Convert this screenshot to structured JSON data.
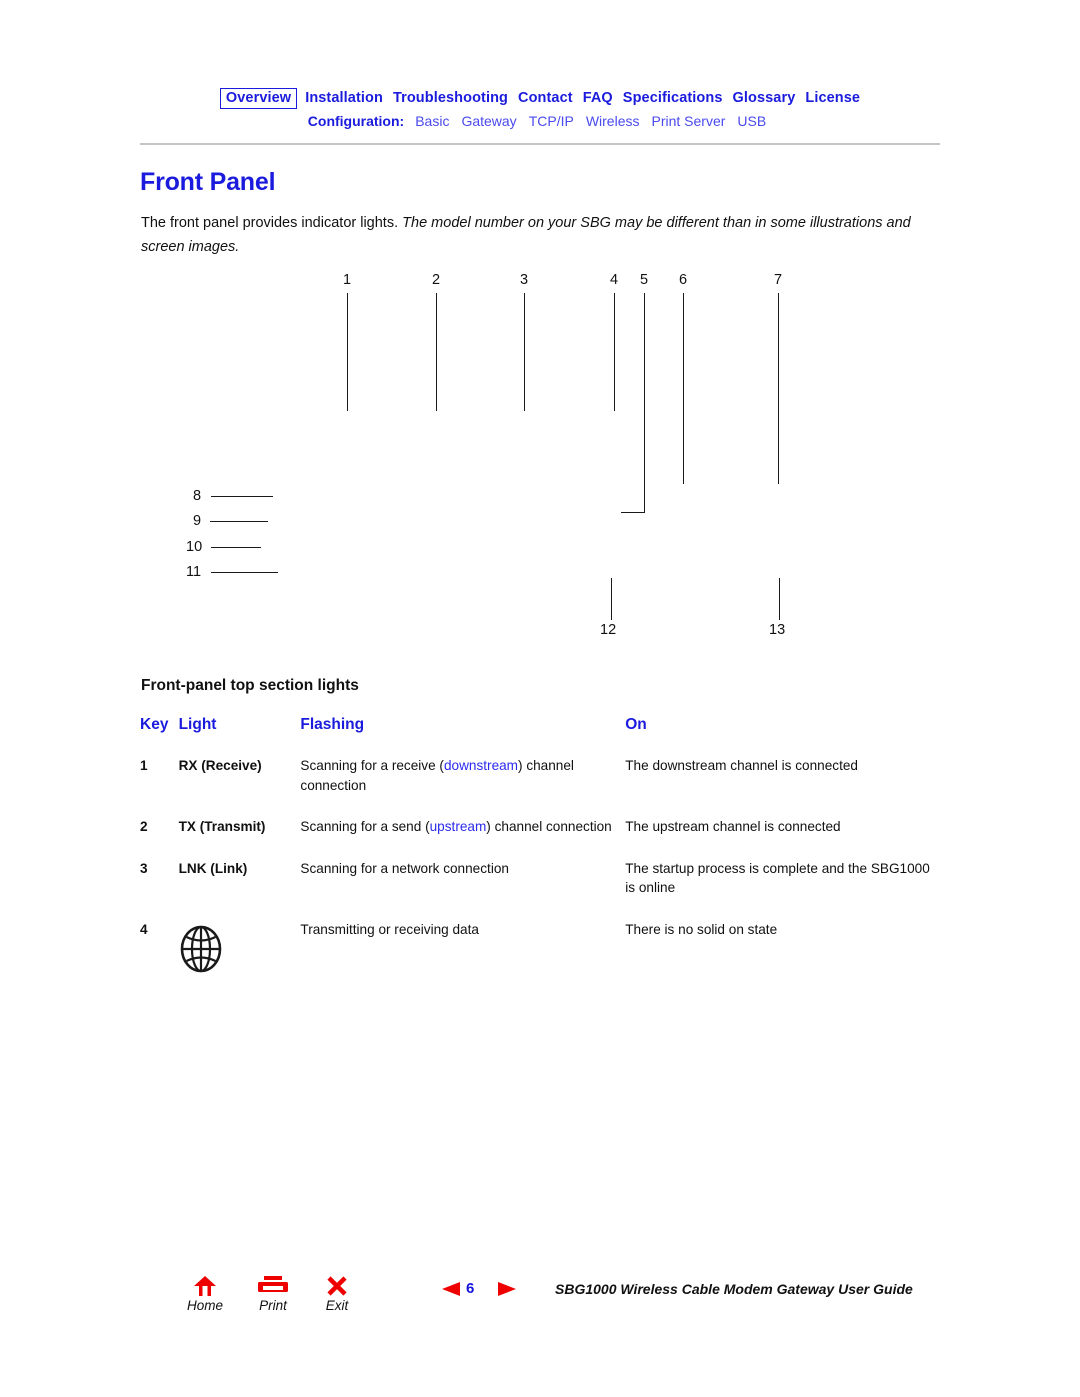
{
  "nav": {
    "primary": [
      {
        "label": "Overview",
        "boxed": true
      },
      {
        "label": "Installation",
        "boxed": false
      },
      {
        "label": "Troubleshooting",
        "boxed": false
      },
      {
        "label": "Contact",
        "boxed": false
      },
      {
        "label": "FAQ",
        "boxed": false
      },
      {
        "label": "Specifications",
        "boxed": false
      },
      {
        "label": "Glossary",
        "boxed": false
      },
      {
        "label": "License",
        "boxed": false
      }
    ],
    "config_label": "Configuration:",
    "config_items": [
      "Basic",
      "Gateway",
      "TCP/IP",
      "Wireless",
      "Print Server",
      "USB"
    ],
    "colors": {
      "primary": "#1b1bdd",
      "secondary": "#4a4aee"
    }
  },
  "page": {
    "title": "Front Panel",
    "intro_plain": "The front panel provides indicator lights. ",
    "intro_italic": "The model number on your SBG may be different than in some illustrations and screen images."
  },
  "diagram": {
    "callouts": [
      "1",
      "2",
      "3",
      "4",
      "5",
      "6",
      "7",
      "8",
      "9",
      "10",
      "11",
      "12",
      "13"
    ]
  },
  "section": {
    "heading": "Front-panel top section lights"
  },
  "table": {
    "headers": [
      "Key",
      "Light",
      "Flashing",
      "On"
    ],
    "rows": [
      {
        "key": "1",
        "light": "RX (Receive)",
        "flashing_pre": "Scanning for a receive (",
        "flashing_link": "downstream",
        "flashing_post": ") channel connection",
        "on": "The downstream channel is connected"
      },
      {
        "key": "2",
        "light": "TX (Transmit)",
        "flashing_pre": "Scanning for a send (",
        "flashing_link": "upstream",
        "flashing_post": ") channel connection",
        "on": "The upstream channel is connected"
      },
      {
        "key": "3",
        "light": "LNK (Link)",
        "flashing_pre": "Scanning for a network connection",
        "flashing_link": "",
        "flashing_post": "",
        "on": "The startup process is complete and the SBG1000 is online"
      },
      {
        "key": "4",
        "light": "",
        "light_icon": "globe-icon",
        "flashing_pre": "Transmitting or receiving data",
        "flashing_link": "",
        "flashing_post": "",
        "on": "There is no solid on state"
      }
    ]
  },
  "footer": {
    "buttons": [
      {
        "label": "Home",
        "icon": "home-icon"
      },
      {
        "label": "Print",
        "icon": "printer-icon"
      },
      {
        "label": "Exit",
        "icon": "close-x-icon"
      }
    ],
    "prev_icon": "triangle-left-icon",
    "next_icon": "triangle-right-icon",
    "page_number": "6",
    "doc_title": "SBG1000 Wireless Cable Modem Gateway User Guide",
    "accent_color": "#ee0000"
  }
}
